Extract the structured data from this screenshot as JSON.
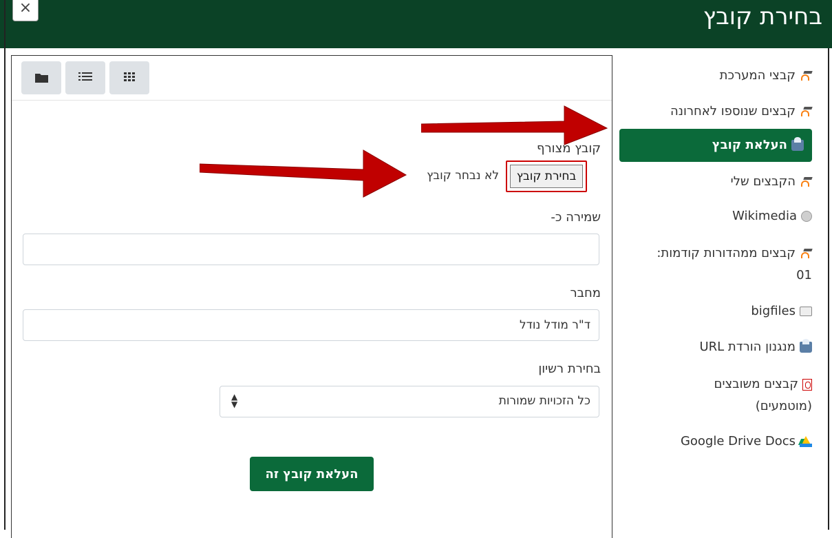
{
  "header": {
    "title": "בחירת קובץ",
    "close_symbol": "×"
  },
  "sidebar": {
    "items": [
      {
        "label": "קבצי המערכת",
        "icon": "moodle-icon"
      },
      {
        "label": "קבצים שנוספו לאחרונה",
        "icon": "moodle-icon"
      },
      {
        "label": "העלאת קובץ",
        "icon": "upload-icon",
        "active": true
      },
      {
        "label": "הקבצים שלי",
        "icon": "moodle-icon"
      },
      {
        "label": "Wikimedia",
        "icon": "globe-icon"
      },
      {
        "label": "קבצים ממהדורות קודמות:",
        "label2": "01",
        "icon": "moodle-icon"
      },
      {
        "label": "bigfiles",
        "icon": "hard-drive-icon"
      },
      {
        "label": "מנגנון הורדת URL",
        "icon": "upload-icon"
      },
      {
        "label": "קבצים משובצים",
        "label2": "(מוטמעים)",
        "icon": "pdf-icon"
      },
      {
        "label": "Google Drive Docs",
        "icon": "google-drive-icon"
      }
    ]
  },
  "toolbar": {
    "buttons": [
      {
        "name": "grid-view",
        "icon": "grid-icon"
      },
      {
        "name": "list-view",
        "icon": "list-icon"
      },
      {
        "name": "folder-view",
        "icon": "folder-icon"
      }
    ]
  },
  "form": {
    "attachment_label": "קובץ מצורף",
    "choose_button": "בחירת קובץ",
    "no_file_text": "לא נבחר קובץ",
    "save_as_label": "שמירה כ-",
    "save_as_value": "",
    "author_label": "מחבר",
    "author_value": "ד\"ר מודל נודל",
    "license_label": "בחירת רשיון",
    "license_value": "כל הזכויות שמורות",
    "upload_button": "העלאת קובץ זה"
  },
  "colors": {
    "header": "#0b4226",
    "accent": "#0b6a3a",
    "arrow": "#c00000"
  }
}
